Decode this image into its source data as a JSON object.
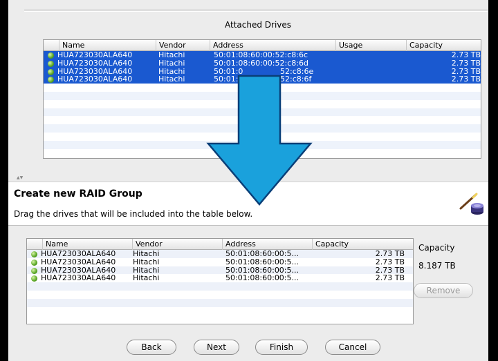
{
  "attached": {
    "title": "Attached Drives",
    "columns": [
      "Name",
      "Vendor",
      "Address",
      "Usage",
      "Capacity"
    ],
    "rows": [
      {
        "name": "HUA723030ALA640",
        "vendor": "Hitachi",
        "address": "50:01:08:60:00:52:c8:6c",
        "usage": "",
        "capacity": "2.73 TB"
      },
      {
        "name": "HUA723030ALA640",
        "vendor": "Hitachi",
        "address": "50:01:08:60:00:52:c8:6d",
        "usage": "",
        "capacity": "2.73 TB"
      },
      {
        "name": "HUA723030ALA640",
        "vendor": "Hitachi",
        "address": "50:01:0",
        "address_tail": "52:c8:6e",
        "usage": "",
        "capacity": "2.73 TB"
      },
      {
        "name": "HUA723030ALA640",
        "vendor": "Hitachi",
        "address": "50:01:0",
        "address_tail": "52:c8:6f",
        "usage": "",
        "capacity": "2.73 TB"
      }
    ]
  },
  "header": {
    "title": "Create new RAID Group",
    "subtitle": "Drag the drives that will be included into the table below."
  },
  "raid": {
    "columns": [
      "Name",
      "Vendor",
      "Address",
      "Capacity"
    ],
    "rows": [
      {
        "name": "HUA723030ALA640",
        "vendor": "Hitachi",
        "address": "50:01:08:60:00:5...",
        "capacity": "2.73 TB"
      },
      {
        "name": "HUA723030ALA640",
        "vendor": "Hitachi",
        "address": "50:01:08:60:00:5...",
        "capacity": "2.73 TB"
      },
      {
        "name": "HUA723030ALA640",
        "vendor": "Hitachi",
        "address": "50:01:08:60:00:5...",
        "capacity": "2.73 TB"
      },
      {
        "name": "HUA723030ALA640",
        "vendor": "Hitachi",
        "address": "50:01:08:60:00:5...",
        "capacity": "2.73 TB"
      }
    ],
    "capacity_label": "Capacity",
    "capacity_value": "8.187 TB",
    "remove_label": "Remove"
  },
  "buttons": {
    "back": "Back",
    "next": "Next",
    "finish": "Finish",
    "cancel": "Cancel"
  },
  "colors": {
    "selection": "#1a59d0",
    "arrow": "#1aa1dc",
    "drive_status": "#58a624"
  },
  "icons": {
    "drive_status": "green-status-dot-icon",
    "header": "magic-wand-disk-icon",
    "drag_hint": "down-arrow-icon"
  }
}
